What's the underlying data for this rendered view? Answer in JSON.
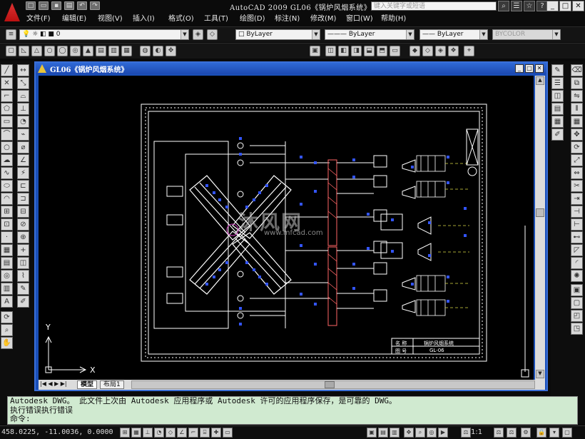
{
  "app": {
    "title": "AutoCAD 2009  GL06《锅炉风烟系统》",
    "search_placeholder": "键入关键字或短语"
  },
  "menu": [
    {
      "label": "文件(F)"
    },
    {
      "label": "编辑(E)"
    },
    {
      "label": "视图(V)"
    },
    {
      "label": "插入(I)"
    },
    {
      "label": "格式(O)"
    },
    {
      "label": "工具(T)"
    },
    {
      "label": "绘图(D)"
    },
    {
      "label": "标注(N)"
    },
    {
      "label": "修改(M)"
    },
    {
      "label": "窗口(W)"
    },
    {
      "label": "帮助(H)"
    }
  ],
  "properties": {
    "layer": "0",
    "color": "ByLayer",
    "linetype": "ByLayer",
    "lineweight": "ByLayer",
    "plotstyle": "BYCOLOR"
  },
  "drawing": {
    "window_title": "GL06《锅炉风烟系统》",
    "watermark_text": "沐风网",
    "watermark_url": "www.mfcad.com",
    "title_block_name_label": "名 称",
    "title_block_name_value": "锅炉风烟系统",
    "title_block_num_label": "图 号",
    "title_block_num_value": "GL-06",
    "ucs_x": "X",
    "ucs_y": "Y"
  },
  "tabs": [
    {
      "label": "模型"
    },
    {
      "label": "布局1"
    }
  ],
  "command": {
    "line1": "Autodesk DWG。  此文件上次由 Autodesk 应用程序或 Autodesk 许可的应用程序保存，是可靠的 DWG。",
    "line2": "执行错误执行错误",
    "prompt": "命令:"
  },
  "status": {
    "coordinates": "458.0225, -11.0036, 0.0000",
    "annotation_scale": "1:1"
  },
  "colors": {
    "drawing_line": "#ffffff",
    "blue_accent": "#3355ff",
    "command_bg": "#d0ead0"
  }
}
